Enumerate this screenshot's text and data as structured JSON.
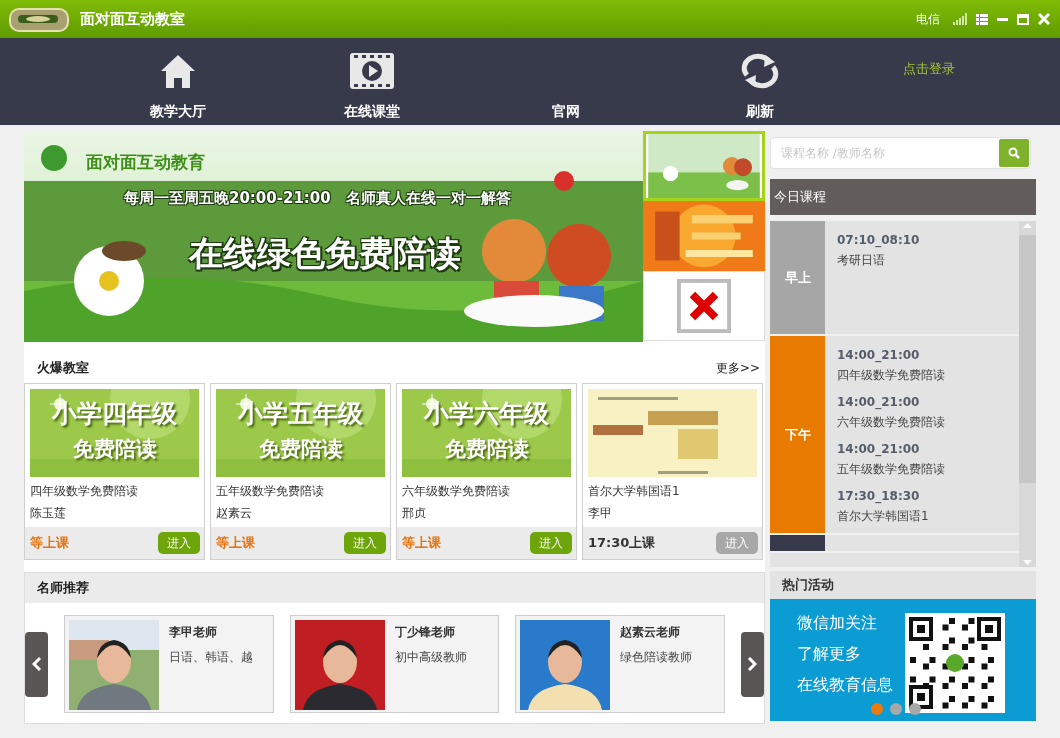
{
  "window": {
    "title": "面对面互动教室",
    "carrier": "电信"
  },
  "nav": {
    "items": [
      {
        "label": "教学大厅",
        "kind": "home"
      },
      {
        "label": "在线课堂",
        "kind": "video"
      },
      {
        "label": "官网",
        "kind": "plain"
      },
      {
        "label": "刷新",
        "kind": "refresh"
      }
    ],
    "login": "点击登录"
  },
  "banner": {
    "brand": "面对面互动教育",
    "line1": "每周一至周五晚20:00-21:00　名师真人在线一对一解答",
    "headline": "在线绿色免费陪读"
  },
  "side_banners": [
    {
      "kind": "green",
      "selected": true
    },
    {
      "kind": "orange",
      "selected": false
    },
    {
      "kind": "broken"
    }
  ],
  "search": {
    "placeholder": "课程名称 /教师名称"
  },
  "hot_classes": {
    "title": "火爆教室",
    "more": "更多>>",
    "cards": [
      {
        "kind": "grade",
        "thumb_lines": [
          "小学四年级",
          "免费陪读"
        ],
        "name": "四年级数学免费陪读",
        "teacher": "陈玉莲",
        "status": "等上课",
        "waiting": true,
        "button": "进入",
        "enabled": true
      },
      {
        "kind": "grade",
        "thumb_lines": [
          "小学五年级",
          "免费陪读"
        ],
        "name": "五年级数学免费陪读",
        "teacher": "赵素云",
        "status": "等上课",
        "waiting": true,
        "button": "进入",
        "enabled": true
      },
      {
        "kind": "grade",
        "thumb_lines": [
          "小学六年级",
          "免费陪读"
        ],
        "name": "六年级数学免费陪读",
        "teacher": "邢贞",
        "status": "等上课",
        "waiting": true,
        "button": "进入",
        "enabled": true
      },
      {
        "kind": "book",
        "name": "首尔大学韩国语1",
        "teacher": "李甲",
        "status": "17:30上课",
        "waiting": false,
        "button": "进入",
        "enabled": false
      }
    ]
  },
  "today": {
    "title": "今日课程",
    "periods": [
      {
        "label": "早上",
        "color": "#a6a6a6",
        "entries": [
          {
            "time": "07:10_08:10",
            "course": "考研日语"
          }
        ]
      },
      {
        "label": "下午",
        "color": "#e87a00",
        "entries": [
          {
            "time": "14:00_21:00",
            "course": "四年级数学免费陪读"
          },
          {
            "time": "14:00_21:00",
            "course": "六年级数学免费陪读"
          },
          {
            "time": "14:00_21:00",
            "course": "五年级数学免费陪读"
          },
          {
            "time": "17:30_18:30",
            "course": "首尔大学韩国语1"
          }
        ]
      },
      {
        "color": "#363a4a"
      }
    ]
  },
  "teachers": {
    "title": "名师推荐",
    "cards": [
      {
        "name": "李甲老师",
        "desc": "日语、韩语、越",
        "kind": "outdoor"
      },
      {
        "name": "丁少锋老师",
        "desc": "初中高级教师",
        "kind": "red"
      },
      {
        "name": "赵素云老师",
        "desc": "绿色陪读教师",
        "kind": "blue"
      }
    ]
  },
  "activity": {
    "title": "热门活动",
    "lines": [
      "微信加关注",
      "了解更多",
      "在线教育信息"
    ],
    "dots": [
      {
        "selected": true
      },
      {
        "selected": false
      },
      {
        "selected": false
      }
    ]
  }
}
